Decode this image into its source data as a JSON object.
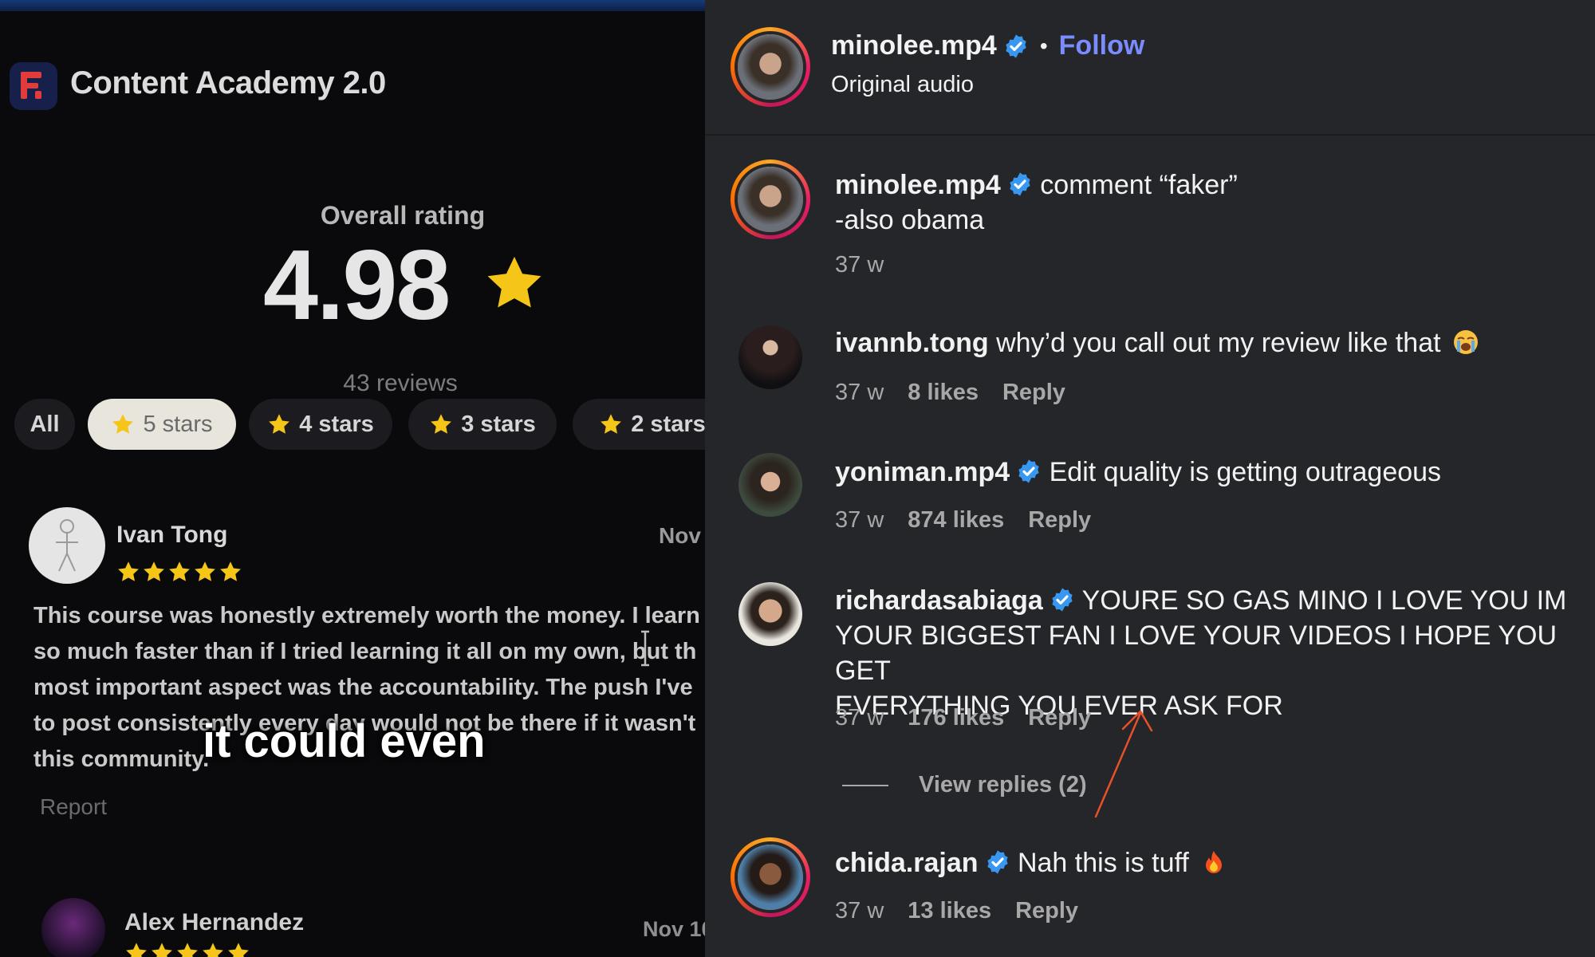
{
  "left_panel": {
    "app_title": "Content Academy 2.0",
    "overall_label": "Overall rating",
    "overall_value": "4.98",
    "reviews_count": "43 reviews",
    "filters": [
      "All",
      "5 stars",
      "4 stars",
      "3 stars",
      "2 stars"
    ],
    "active_filter": "5 stars",
    "review": {
      "name": "Ivan Tong",
      "date": "Nov",
      "stars": 5,
      "lines": [
        "This course was honestly extremely worth the money. I learn",
        "so much faster than if I tried learning it all on my own, but th",
        "most important aspect was the accountability. The push I've",
        "to post consistently every day would not be there if it wasn't",
        "this community."
      ],
      "report_label": "Report"
    },
    "caption": "it could even",
    "review2": {
      "name": "Alex Hernandez",
      "date": "Nov 10",
      "stars": 5
    }
  },
  "post_header": {
    "username": "minolee.mp4",
    "separator": "•",
    "follow_label": "Follow",
    "audio": "Original audio"
  },
  "comments": [
    {
      "username": "minolee.mp4",
      "verified": true,
      "text": "comment “faker”",
      "text2": "-also obama",
      "age": "37 w"
    },
    {
      "username": "ivannb.tong",
      "verified": false,
      "text": "why’d you call out my review like that",
      "emoji": "loudly-crying-face",
      "age": "37 w",
      "likes": "8 likes",
      "reply": "Reply"
    },
    {
      "username": "yoniman.mp4",
      "verified": true,
      "text": "Edit quality is getting outrageous",
      "age": "37 w",
      "likes": "874 likes",
      "reply": "Reply"
    },
    {
      "username": "richardasabiaga",
      "verified": true,
      "text_line1": "YOURE SO GAS MINO I LOVE YOU IM",
      "text_line2": "YOUR BIGGEST FAN I LOVE YOUR VIDEOS I HOPE YOU GET",
      "text_line3": "EVERYTHING YOU EVER ASK FOR",
      "age": "37 w",
      "likes": "176 likes",
      "reply": "Reply",
      "view_replies": "View replies (2)"
    },
    {
      "username": "chida.rajan",
      "verified": true,
      "text": "Nah this is tuff",
      "emoji": "fire",
      "age": "37 w",
      "likes": "13 likes",
      "reply": "Reply"
    }
  ],
  "colors": {
    "follow": "#7b8cff",
    "verified": "#3897f0",
    "star": "#f5c518",
    "arrow": "#e8502a",
    "panel_bg": "#252629"
  }
}
